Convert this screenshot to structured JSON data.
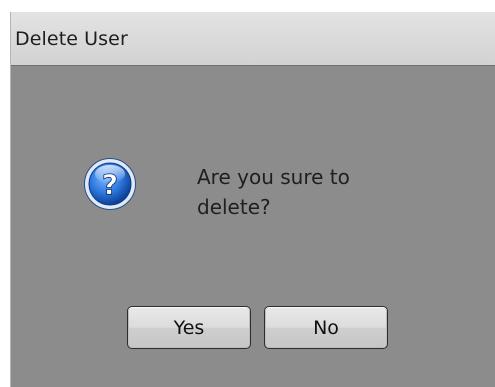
{
  "dialog": {
    "title": "Delete User",
    "message": "Are you sure to delete?",
    "icon": "question-icon",
    "buttons": {
      "yes": "Yes",
      "no": "No"
    }
  },
  "colors": {
    "dialog_background": "#8c8c8c",
    "titlebar_background": "#d9d9d9",
    "icon_blue": "#1a5fbf"
  }
}
